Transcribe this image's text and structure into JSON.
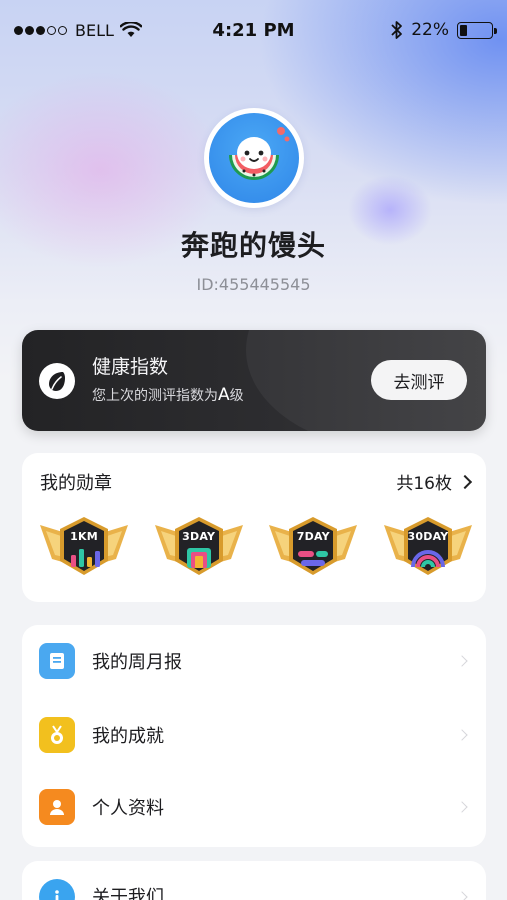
{
  "status_bar": {
    "carrier": "BELL",
    "time": "4:21 PM",
    "battery": "22%",
    "battery_level": 0.22,
    "signal_bars_filled": 3,
    "signal_bars_total": 5
  },
  "profile": {
    "name": "奔跑的馒头",
    "id": "ID:455445545"
  },
  "health": {
    "title": "健康指数",
    "subtitle_prefix": "您上次的测评指数为",
    "grade": "A",
    "grade_suffix": "级",
    "button": "去测评"
  },
  "medals": {
    "title": "我的勋章",
    "count": "共16枚",
    "items": [
      {
        "label": "1KM"
      },
      {
        "label": "3DAY"
      },
      {
        "label": "7DAY"
      },
      {
        "label": "30DAY"
      }
    ]
  },
  "menu": {
    "items": [
      {
        "label": "我的周月报",
        "icon": "report-icon",
        "color": "#4aa8f0"
      },
      {
        "label": "我的成就",
        "icon": "medal-icon",
        "color": "#f2c01e"
      },
      {
        "label": "个人资料",
        "icon": "person-icon",
        "color": "#f58a1f"
      }
    ],
    "about": {
      "label": "关于我们",
      "icon": "info-icon",
      "color": "#3aa4ef"
    }
  },
  "colors": {
    "accent_blue": "#6086f2",
    "card_dark": "#2a2a2d"
  }
}
